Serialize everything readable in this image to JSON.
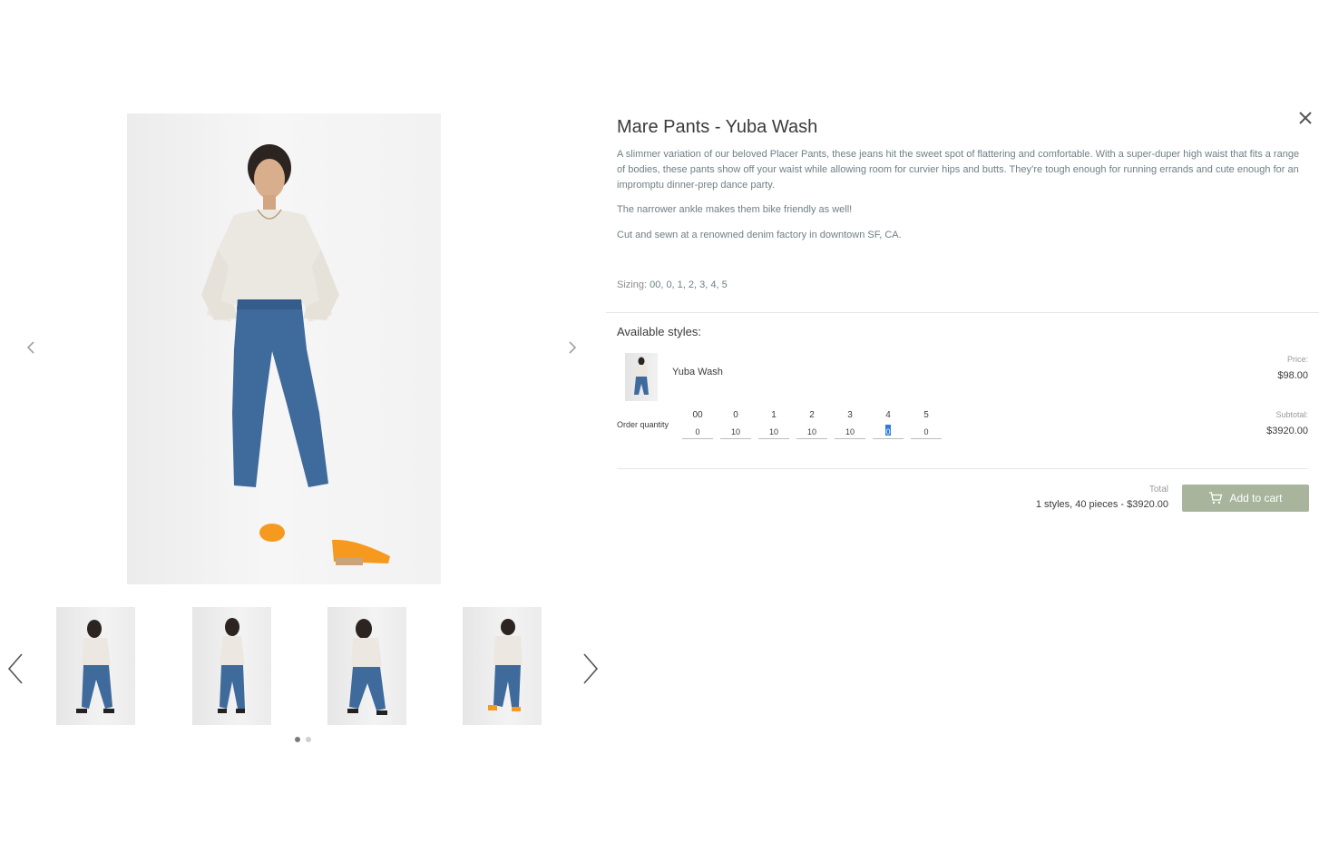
{
  "product": {
    "title": "Mare Pants - Yuba Wash",
    "description": [
      "A slimmer variation of our beloved Placer Pants, these jeans hit the sweet spot of flattering and comfortable. With a super-duper high waist that fits a range of bodies, these pants show off your waist while allowing room for curvier hips and butts. They’re tough enough for running errands and cute enough for an impromptu dinner-prep dance party.",
      "The narrower ankle makes them bike friendly as well!",
      "Cut and sewn at a renowned denim factory in downtown SF, CA."
    ],
    "sizing_label": "Sizing:",
    "sizing_values": "00, 0, 1, 2, 3, 4, 5"
  },
  "styles": {
    "heading": "Available styles:",
    "style_name": "Yuba Wash",
    "price_label": "Price:",
    "price_value": "$98.00",
    "subtotal_label": "Subtotal:",
    "subtotal_value": "$3920.00",
    "order_quantity_label": "Order quantity",
    "sizes": [
      {
        "label": "00",
        "qty": "0"
      },
      {
        "label": "0",
        "qty": "10"
      },
      {
        "label": "1",
        "qty": "10"
      },
      {
        "label": "2",
        "qty": "10"
      },
      {
        "label": "3",
        "qty": "10"
      },
      {
        "label": "4",
        "qty": "0"
      },
      {
        "label": "5",
        "qty": "0"
      }
    ]
  },
  "summary": {
    "total_label": "Total",
    "total_value": "1 styles, 40 pieces - $3920.00",
    "add_to_cart": "Add to cart"
  },
  "gallery": {
    "thumbnail_count": 4,
    "page_dots": 2,
    "active_dot": 0
  },
  "icons": {
    "close": "close-icon",
    "prev": "chevron-left-icon",
    "next": "chevron-right-icon",
    "cart": "cart-icon"
  },
  "colors": {
    "description_text": "#6e7f86",
    "cart_button": "#a8b59c",
    "denim": "#3f6a9c",
    "clogs": "#f59a1e"
  }
}
